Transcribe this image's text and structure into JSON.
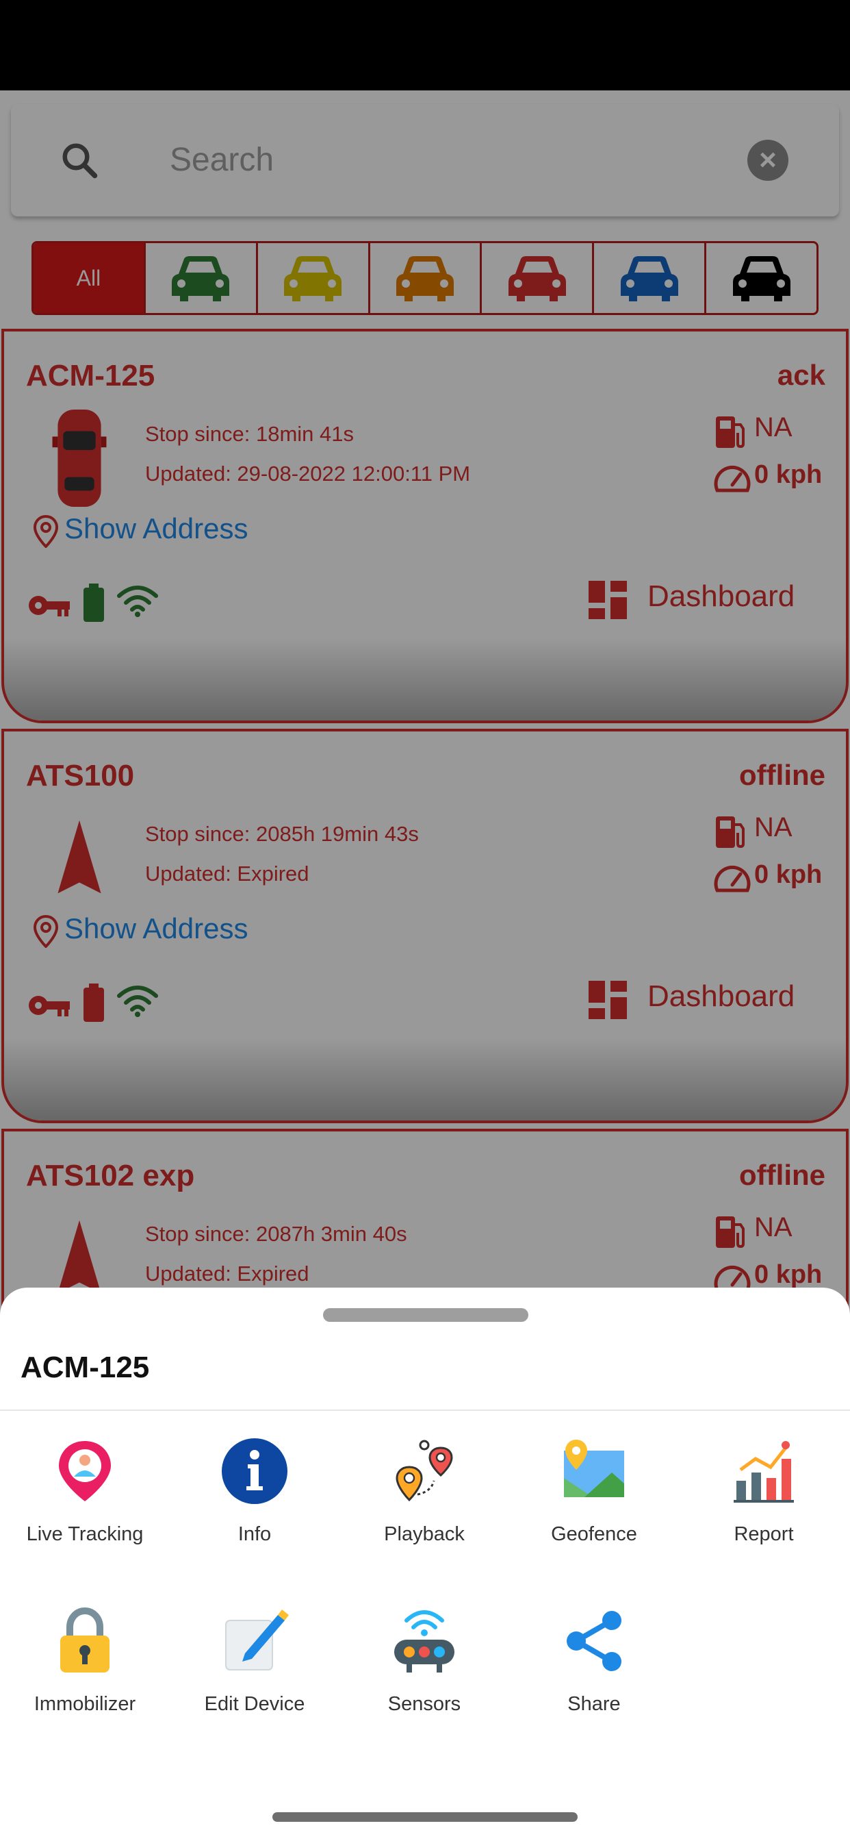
{
  "search": {
    "placeholder": "Search",
    "clear_icon": "close-icon"
  },
  "filters": {
    "all_label": "All",
    "car_colors": [
      "#2e7d32",
      "#c9b400",
      "#e07b00",
      "#d32f2f",
      "#1565c0",
      "#000000"
    ]
  },
  "devices": [
    {
      "name": "ACM-125",
      "status": "ack",
      "stop_since": "Stop since: 18min 41s",
      "updated": "Updated: 29-08-2022 12:00:11 PM",
      "fuel": "NA",
      "speed": "0 kph",
      "address_link": "Show Address",
      "dashboard_label": "Dashboard",
      "battery_color": "#2e7d32",
      "wifi_color": "#2e7d32"
    },
    {
      "name": "ATS100",
      "status": "offline",
      "stop_since": "Stop since: 2085h 19min 43s",
      "updated": "Updated: Expired",
      "fuel": "NA",
      "speed": "0 kph",
      "address_link": "Show Address",
      "dashboard_label": "Dashboard",
      "battery_color": "#d32f2f",
      "wifi_color": "#2e7d32"
    },
    {
      "name": "ATS102 exp",
      "status": "offline",
      "stop_since": "Stop since: 2087h 3min 40s",
      "updated": "Updated: Expired",
      "fuel": "NA",
      "speed": "0 kph"
    }
  ],
  "sheet": {
    "title": "ACM-125",
    "actions": [
      {
        "label": "Live Tracking",
        "icon": "live-tracking-icon"
      },
      {
        "label": "Info",
        "icon": "info-icon"
      },
      {
        "label": "Playback",
        "icon": "playback-icon"
      },
      {
        "label": "Geofence",
        "icon": "geofence-icon"
      },
      {
        "label": "Report",
        "icon": "report-icon"
      },
      {
        "label": "Immobilizer",
        "icon": "lock-icon"
      },
      {
        "label": "Edit Device",
        "icon": "edit-icon"
      },
      {
        "label": "Sensors",
        "icon": "sensors-icon"
      },
      {
        "label": "Share",
        "icon": "share-icon"
      }
    ]
  },
  "colors": {
    "accent": "#d32f2f",
    "link": "#1e88e5"
  }
}
